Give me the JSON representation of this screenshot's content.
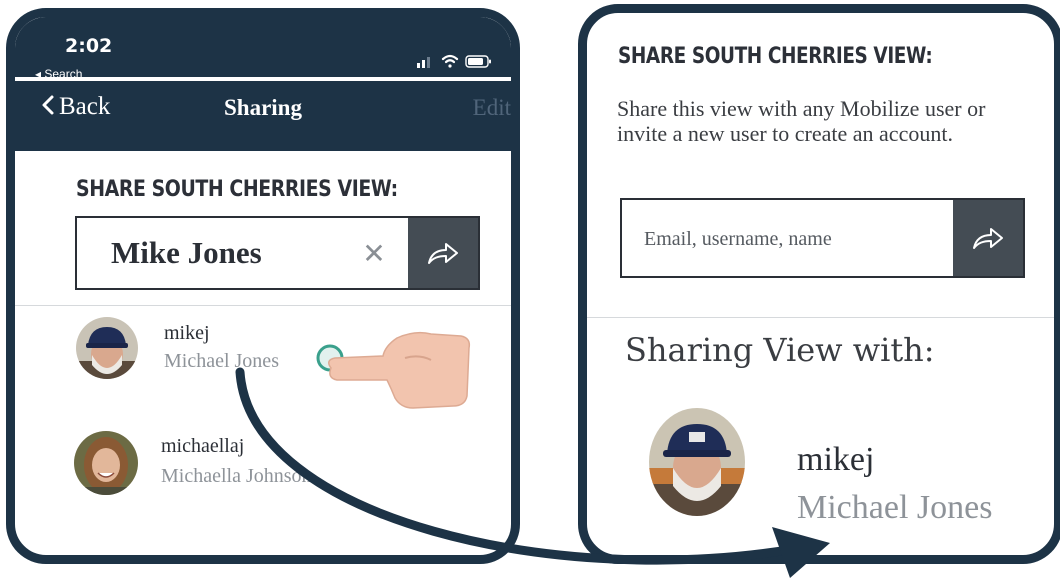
{
  "phone": {
    "status": {
      "time": "2:02",
      "back_app": "◂ Search"
    },
    "nav": {
      "back_label": "Back",
      "title": "Sharing",
      "edit_label": "Edit"
    },
    "heading": "SHARE SOUTH CHERRIES VIEW:",
    "search": {
      "value": "Mike Jones",
      "clear_glyph": "✕"
    },
    "results": [
      {
        "username": "mikej",
        "full_name": "Michael Jones"
      },
      {
        "username": "michaellaj",
        "full_name": "Michaella Johnson"
      }
    ]
  },
  "panel": {
    "heading": "SHARE SOUTH CHERRIES VIEW:",
    "description": "Share this view with any Mobilize user or invite a new user to create an account.",
    "search": {
      "placeholder": "Email, username, name"
    },
    "shared_heading": "Sharing View with:",
    "shared_users": [
      {
        "username": "mikej",
        "full_name": "Michael Jones"
      }
    ]
  },
  "icons": {
    "share": "share-arrow-icon",
    "clear": "close-icon",
    "back": "chevron-left-icon",
    "pointer": "hand-pointer-icon"
  },
  "colors": {
    "navy": "#1d3346",
    "share_button": "#444c54",
    "tap_indicator": "#3aa08c",
    "hand": "#f2c4ae"
  }
}
